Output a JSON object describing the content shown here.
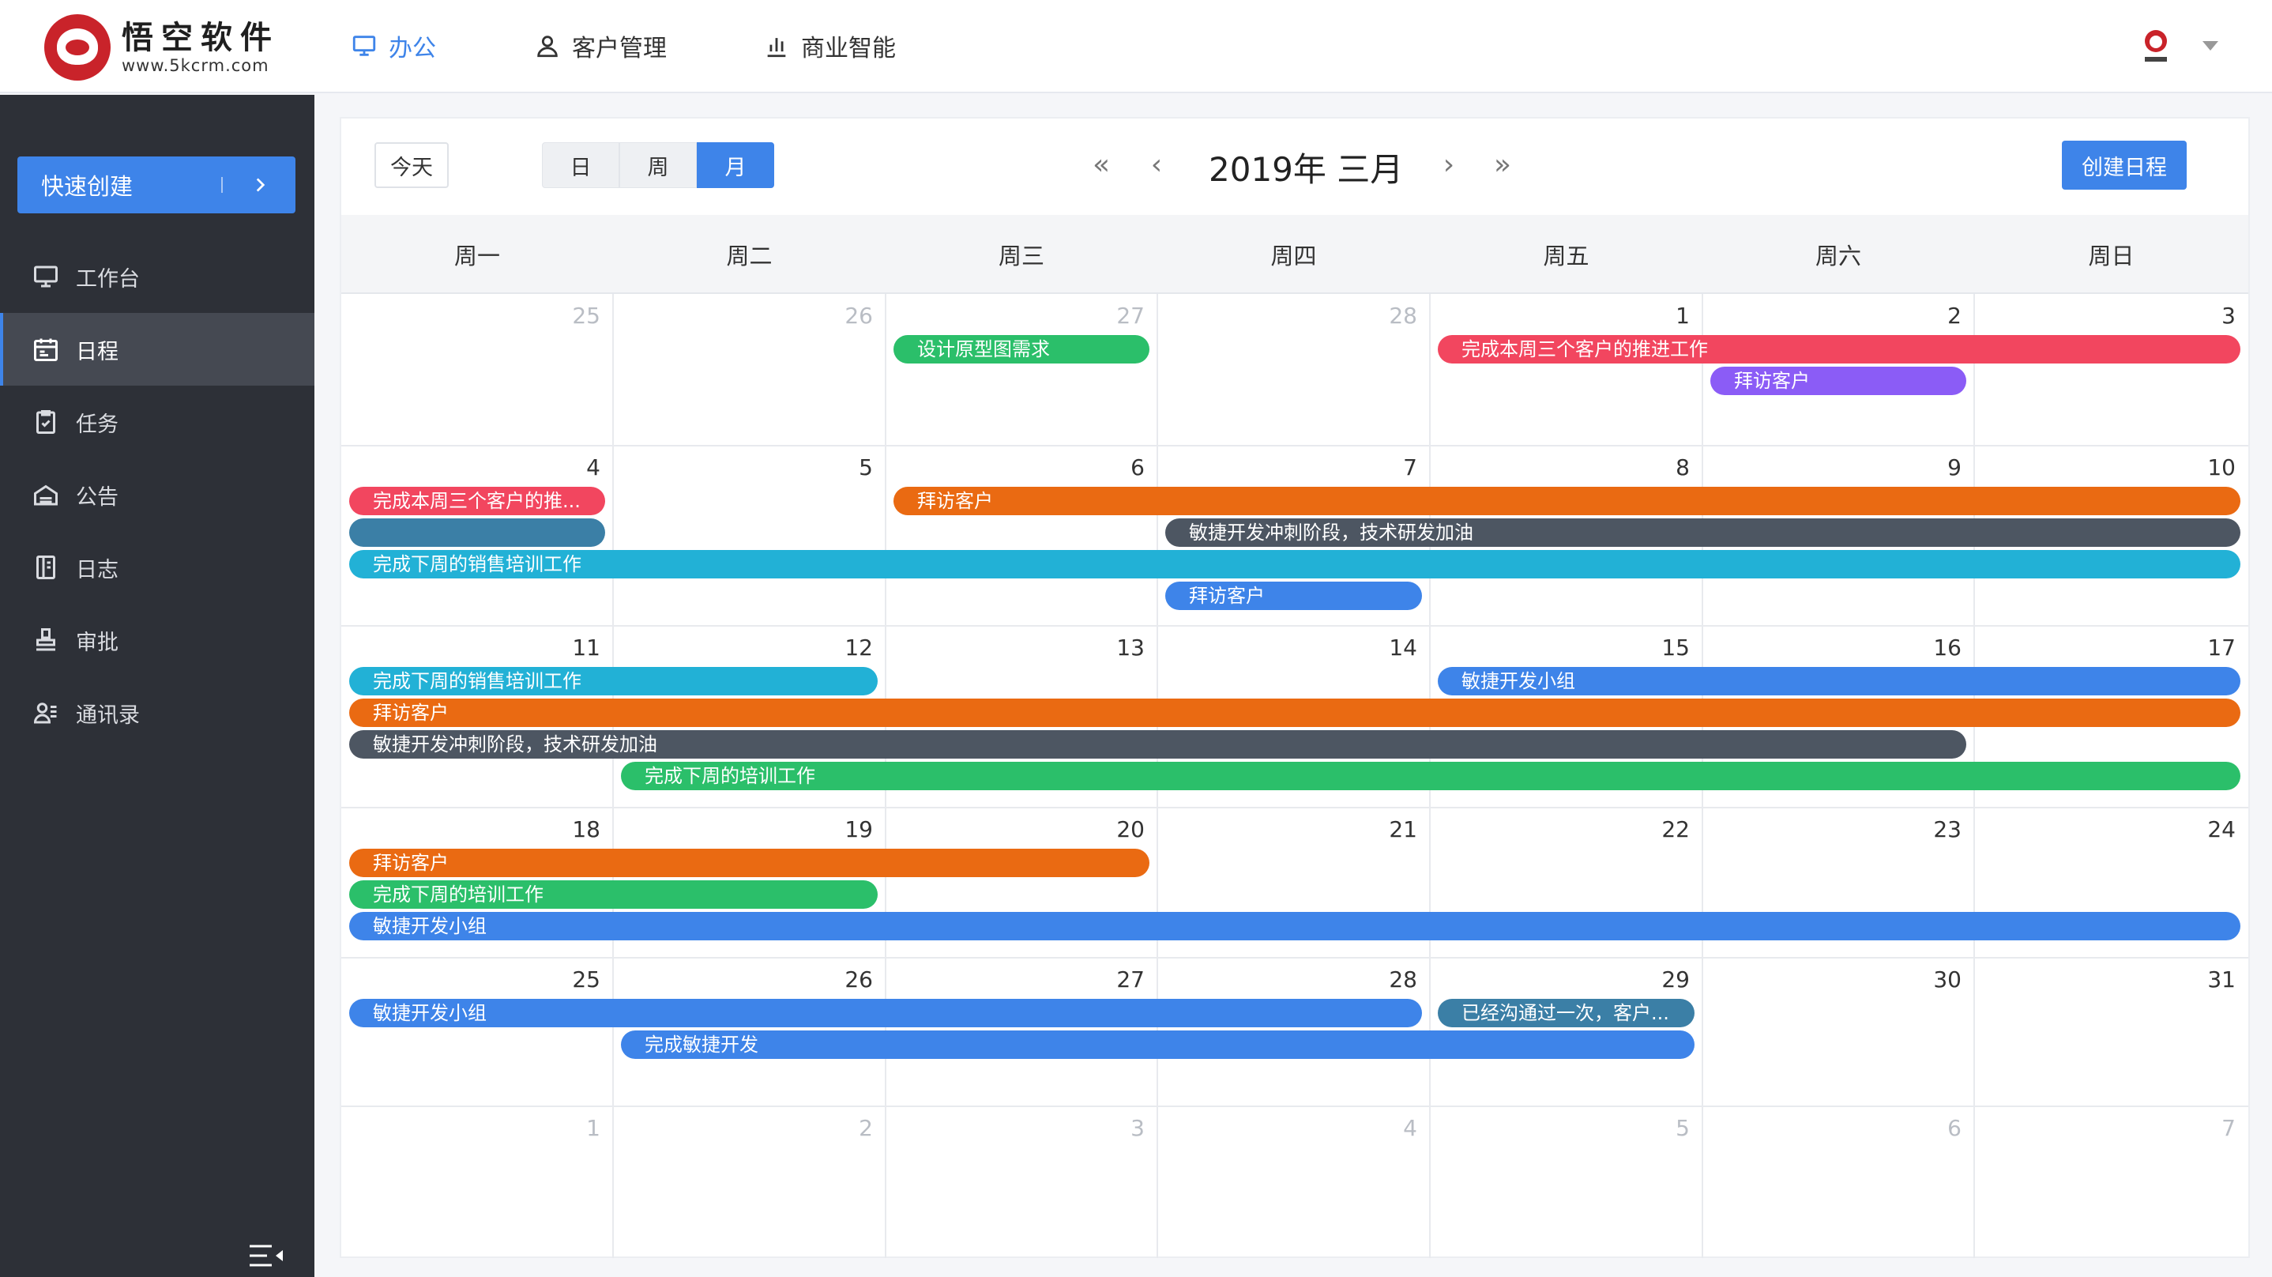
{
  "app": {
    "logo_title": "悟空软件",
    "logo_sub": "www.5kcrm.com",
    "brand_color": "#c9232a"
  },
  "topnav": [
    {
      "label": "办公",
      "icon": "monitor-icon",
      "active": true
    },
    {
      "label": "客户管理",
      "icon": "user-icon",
      "active": false
    },
    {
      "label": "商业智能",
      "icon": "bar-chart-icon",
      "active": false
    }
  ],
  "sidebar": {
    "quick_create": "快速创建",
    "items": [
      {
        "label": "工作台",
        "icon": "monitor-icon"
      },
      {
        "label": "日程",
        "icon": "calendar-icon",
        "active": true
      },
      {
        "label": "任务",
        "icon": "clipboard-icon"
      },
      {
        "label": "公告",
        "icon": "megaphone-icon"
      },
      {
        "label": "日志",
        "icon": "book-icon"
      },
      {
        "label": "审批",
        "icon": "stamp-icon"
      },
      {
        "label": "通讯录",
        "icon": "contacts-icon"
      }
    ]
  },
  "toolbar": {
    "today": "今天",
    "views": [
      "日",
      "周",
      "月"
    ],
    "active_view": "月",
    "prev_year": "«",
    "prev": "‹",
    "title": "2019年 三月",
    "next": "›",
    "next_year": "»",
    "create": "创建日程"
  },
  "weekdays": [
    "周一",
    "周二",
    "周三",
    "周四",
    "周五",
    "周六",
    "周日"
  ],
  "weeks": [
    [
      {
        "d": "25",
        "dim": true
      },
      {
        "d": "26",
        "dim": true
      },
      {
        "d": "27",
        "dim": true
      },
      {
        "d": "28",
        "dim": true
      },
      {
        "d": "1"
      },
      {
        "d": "2"
      },
      {
        "d": "3"
      }
    ],
    [
      {
        "d": "4"
      },
      {
        "d": "5"
      },
      {
        "d": "6"
      },
      {
        "d": "7"
      },
      {
        "d": "8"
      },
      {
        "d": "9"
      },
      {
        "d": "10"
      }
    ],
    [
      {
        "d": "11"
      },
      {
        "d": "12"
      },
      {
        "d": "13"
      },
      {
        "d": "14"
      },
      {
        "d": "15"
      },
      {
        "d": "16"
      },
      {
        "d": "17"
      }
    ],
    [
      {
        "d": "18"
      },
      {
        "d": "19"
      },
      {
        "d": "20"
      },
      {
        "d": "21"
      },
      {
        "d": "22"
      },
      {
        "d": "23"
      },
      {
        "d": "24"
      }
    ],
    [
      {
        "d": "25"
      },
      {
        "d": "26"
      },
      {
        "d": "27"
      },
      {
        "d": "28"
      },
      {
        "d": "29"
      },
      {
        "d": "30"
      },
      {
        "d": "31"
      }
    ],
    [
      {
        "d": "1",
        "dim": true
      },
      {
        "d": "2",
        "dim": true
      },
      {
        "d": "3",
        "dim": true
      },
      {
        "d": "4",
        "dim": true
      },
      {
        "d": "5",
        "dim": true
      },
      {
        "d": "6",
        "dim": true
      },
      {
        "d": "7",
        "dim": true
      }
    ]
  ],
  "events": [
    {
      "title": "设计原型图需求",
      "week": 0,
      "start": 2,
      "end": 2,
      "lane": 0,
      "color": "#2bbf6a"
    },
    {
      "title": "完成本周三个客户的推进工作",
      "week": 0,
      "start": 4,
      "end": 6,
      "lane": 0,
      "color": "#f2465f"
    },
    {
      "title": "拜访客户",
      "week": 0,
      "start": 5,
      "end": 5,
      "lane": 1,
      "color": "#8b5cf6"
    },
    {
      "title": "完成本周三个客户的推...",
      "week": 1,
      "start": 0,
      "end": 0,
      "lane": 0,
      "color": "#f2465f"
    },
    {
      "title": "拜访客户",
      "week": 1,
      "start": 2,
      "end": 6,
      "lane": 0,
      "color": "#ea6a12"
    },
    {
      "title": "",
      "week": 1,
      "start": 0,
      "end": 0,
      "lane": 1,
      "color": "#3b7fa6"
    },
    {
      "title": "敏捷开发冲刺阶段，技术研发加油",
      "week": 1,
      "start": 3,
      "end": 6,
      "lane": 1,
      "color": "#4d5662"
    },
    {
      "title": "完成下周的销售培训工作",
      "week": 1,
      "start": 0,
      "end": 6,
      "lane": 2,
      "color": "#22b1d6"
    },
    {
      "title": "拜访客户",
      "week": 1,
      "start": 3,
      "end": 3,
      "lane": 3,
      "color": "#3e84e9"
    },
    {
      "title": "完成下周的销售培训工作",
      "week": 2,
      "start": 0,
      "end": 1,
      "lane": 0,
      "color": "#22b1d6"
    },
    {
      "title": "敏捷开发小组",
      "week": 2,
      "start": 4,
      "end": 6,
      "lane": 0,
      "color": "#3e84e9"
    },
    {
      "title": "拜访客户",
      "week": 2,
      "start": 0,
      "end": 6,
      "lane": 1,
      "color": "#ea6a12"
    },
    {
      "title": "敏捷开发冲刺阶段，技术研发加油",
      "week": 2,
      "start": 0,
      "end": 5,
      "lane": 2,
      "color": "#4d5662"
    },
    {
      "title": "完成下周的培训工作",
      "week": 2,
      "start": 1,
      "end": 6,
      "lane": 3,
      "color": "#2bbf6a"
    },
    {
      "title": "拜访客户",
      "week": 3,
      "start": 0,
      "end": 2,
      "lane": 0,
      "color": "#ea6a12"
    },
    {
      "title": "完成下周的培训工作",
      "week": 3,
      "start": 0,
      "end": 1,
      "lane": 1,
      "color": "#2bbf6a"
    },
    {
      "title": "敏捷开发小组",
      "week": 3,
      "start": 0,
      "end": 6,
      "lane": 2,
      "color": "#3e84e9"
    },
    {
      "title": "敏捷开发小组",
      "week": 4,
      "start": 0,
      "end": 3,
      "lane": 0,
      "color": "#3e84e9"
    },
    {
      "title": "已经沟通过一次，客户...",
      "week": 4,
      "start": 4,
      "end": 4,
      "lane": 0,
      "color": "#3b7fa6"
    },
    {
      "title": "完成敏捷开发",
      "week": 4,
      "start": 1,
      "end": 4,
      "lane": 1,
      "color": "#3e84e9"
    }
  ]
}
